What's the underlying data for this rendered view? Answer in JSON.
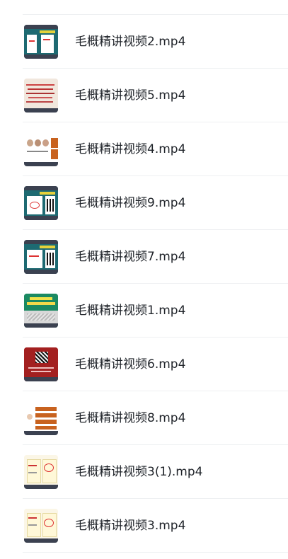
{
  "files": [
    {
      "name": "毛概精讲视频2.mp4",
      "thumb": "teal-slide"
    },
    {
      "name": "毛概精讲视频5.mp4",
      "thumb": "beige-text-slide"
    },
    {
      "name": "毛概精讲视频4.mp4",
      "thumb": "portrait-slide"
    },
    {
      "name": "毛概精讲视频9.mp4",
      "thumb": "teal-qr-slide"
    },
    {
      "name": "毛概精讲视频7.mp4",
      "thumb": "teal-qr-slide"
    },
    {
      "name": "毛概精讲视频1.mp4",
      "thumb": "green-title-slide"
    },
    {
      "name": "毛概精讲视频6.mp4",
      "thumb": "red-slide"
    },
    {
      "name": "毛概精讲视频8.mp4",
      "thumb": "orange-list-slide"
    },
    {
      "name": "毛概精讲视频3(1).mp4",
      "thumb": "cream-notes-slide"
    },
    {
      "name": "毛概精讲视频3.mp4",
      "thumb": "cream-notes-slide"
    }
  ]
}
